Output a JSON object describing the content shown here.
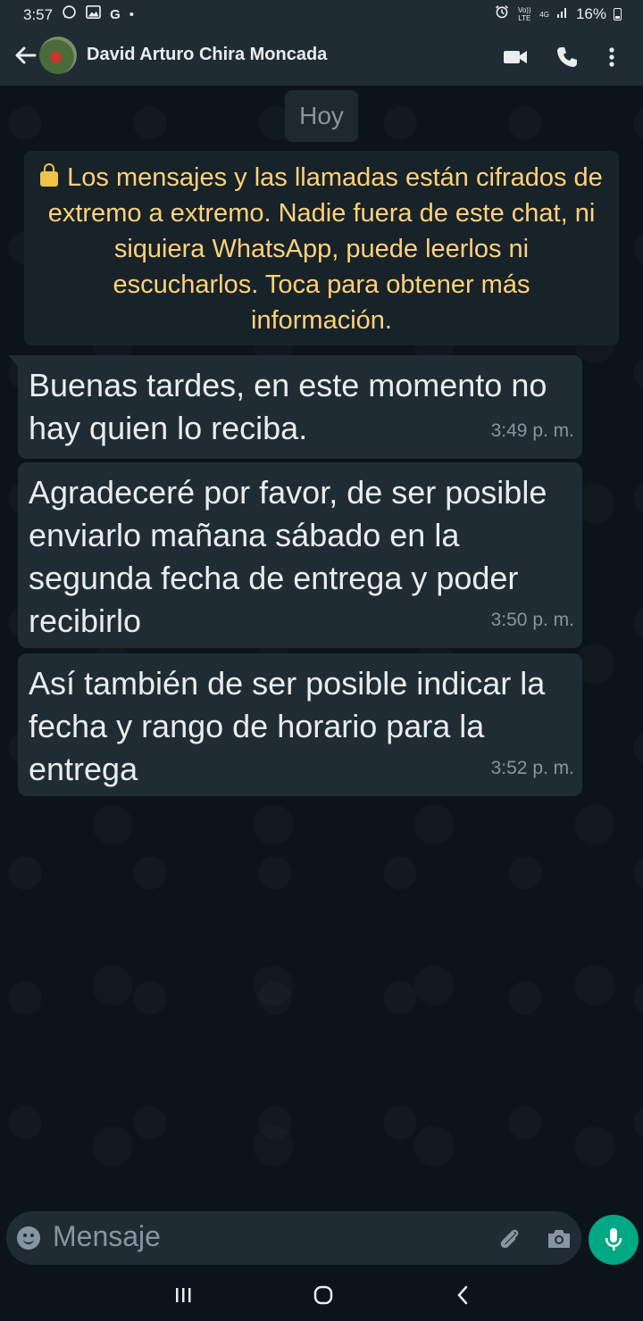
{
  "status_bar": {
    "time": "3:57",
    "volte": "Vo)) LTE",
    "network": "4G",
    "battery": "16%"
  },
  "header": {
    "contact_name": "David Arturo Chira Moncada"
  },
  "chat": {
    "date_chip": "Hoy",
    "encryption_notice": "Los mensajes y las llamadas están cifrados de extremo a extremo. Nadie fuera de este chat, ni siquiera WhatsApp, puede leerlos ni escucharlos. Toca para obtener más información.",
    "messages": [
      {
        "text": "Buenas tardes, en este momento no hay quien lo reciba.",
        "time": "3:49 p. m."
      },
      {
        "text": "Agradeceré por favor, de ser posible enviarlo mañana sábado en la segunda fecha de entrega y poder recibirlo",
        "time": "3:50 p. m."
      },
      {
        "text": "Así también de ser posible indicar la fecha y rango de horario para la entrega",
        "time": "3:52 p. m."
      }
    ]
  },
  "composer": {
    "placeholder": "Mensaje"
  },
  "colors": {
    "background": "#0b141a",
    "bar": "#1f2c34",
    "bubble": "#1f2c34",
    "accent": "#00a884",
    "encryption_text": "#ffd279"
  },
  "icons": [
    "whatsapp-icon",
    "gallery-icon",
    "google-icon",
    "alarm-icon",
    "signal-icon",
    "battery-icon",
    "back-arrow-icon",
    "video-call-icon",
    "phone-icon",
    "more-options-icon",
    "lock-icon",
    "emoji-icon",
    "attach-icon",
    "camera-icon",
    "mic-icon",
    "recent-apps-icon",
    "home-icon",
    "back-icon"
  ]
}
